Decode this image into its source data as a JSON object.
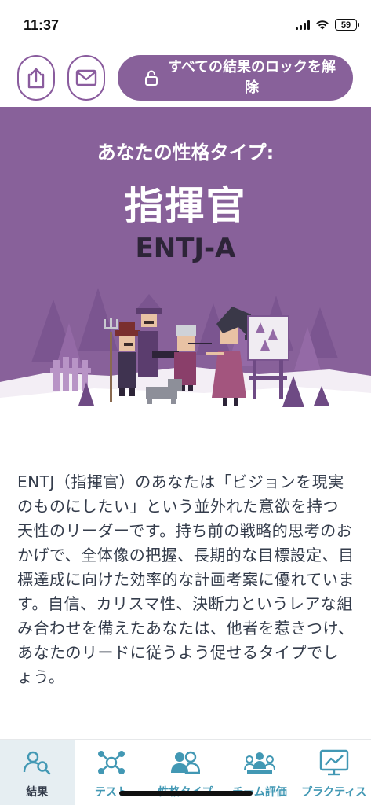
{
  "status_bar": {
    "time": "11:37",
    "battery": "59"
  },
  "toolbar": {
    "share_icon": "share-icon",
    "mail_icon": "mail-icon",
    "unlock_label": "すべての結果のロックを解除"
  },
  "hero": {
    "heading": "あなたの性格タイプ:",
    "title": "指揮官",
    "code": "ENTJ-A",
    "background_color": "#88619a"
  },
  "description": "ENTJ（指揮官）のあなたは「ビジョンを現実のものにしたい」という並外れた意欲を持つ天性のリーダーです。持ち前の戦略的思考のおかげで、全体像の把握、長期的な目標設定、目標達成に向けた効率的な計画考案に優れています。自信、カリスマ性、決断力というレアな組み合わせを備えたあなたは、他者を惹きつけ、あなたのリードに従うよう促せるタイプでしょう。",
  "bottom_nav": {
    "items": [
      {
        "label": "結果",
        "icon": "results-icon",
        "active": true
      },
      {
        "label": "テスト",
        "icon": "test-icon",
        "active": false
      },
      {
        "label": "性格タイプ",
        "icon": "personality-types-icon",
        "active": false
      },
      {
        "label": "チーム評価",
        "icon": "team-assessment-icon",
        "active": false
      },
      {
        "label": "プラクティス",
        "icon": "practice-icon",
        "active": false
      }
    ],
    "accent_color": "#4298b4"
  }
}
